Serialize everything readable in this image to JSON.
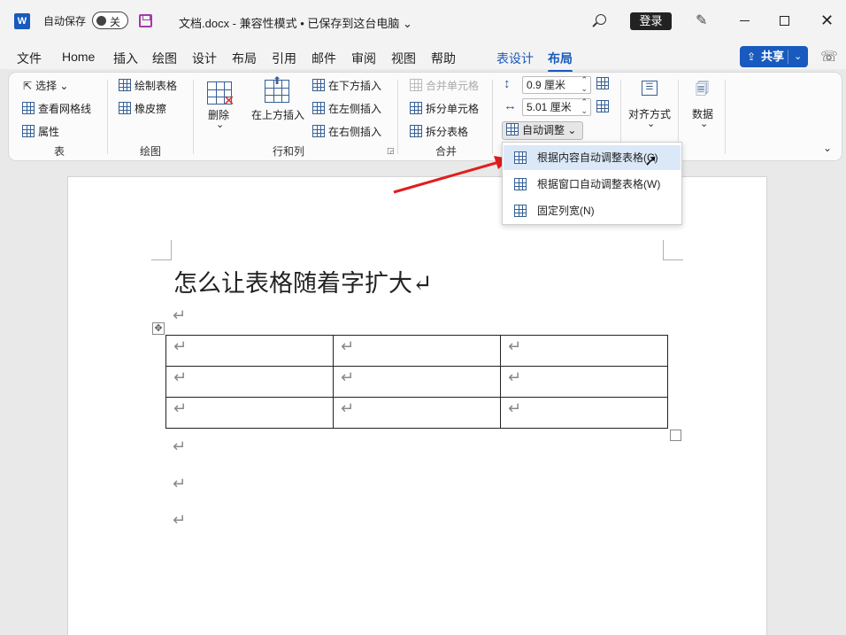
{
  "titlebar": {
    "app_logo": "W",
    "autosave_label": "自动保存",
    "autosave_state": "关",
    "doc_title": "文档.docx  -  兼容性模式 • 已保存到这台电脑 ⌄",
    "login_label": "登录"
  },
  "tabs": [
    "文件",
    "Home",
    "插入",
    "绘图",
    "设计",
    "布局",
    "引用",
    "邮件",
    "审阅",
    "视图",
    "帮助",
    "表设计",
    "布局"
  ],
  "share": {
    "label": "共享"
  },
  "ribbon": {
    "table_group": {
      "label": "表",
      "items": [
        "选择",
        "查看网格线",
        "属性"
      ]
    },
    "draw_group": {
      "label": "绘图",
      "items": [
        "绘制表格",
        "橡皮擦"
      ]
    },
    "delete_label": "删除",
    "rowscols_group": {
      "label": "行和列",
      "insert_above": "在上方插入",
      "items": [
        "在下方插入",
        "在左侧插入",
        "在右侧插入"
      ]
    },
    "merge_group": {
      "label": "合并",
      "items": [
        "合并单元格",
        "拆分单元格",
        "拆分表格"
      ]
    },
    "cellsize": {
      "height_value": "0.9 厘米",
      "width_value": "5.01 厘米",
      "autofit_label": "自动调整"
    },
    "align_label": "对齐方式",
    "data_label": "数据"
  },
  "autofit_menu": {
    "items": [
      "根据内容自动调整表格(C)",
      "根据窗口自动调整表格(W)",
      "固定列宽(N)"
    ]
  },
  "document": {
    "heading": "怎么让表格随着字扩大↵",
    "para_mark": "↵",
    "table": {
      "rows": 3,
      "cols": 3
    }
  }
}
